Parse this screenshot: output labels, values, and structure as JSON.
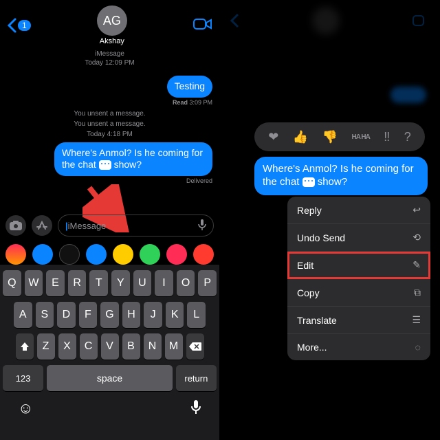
{
  "left": {
    "backCount": "1",
    "avatarInitials": "AG",
    "contactName": "Akshay",
    "serviceLabel": "iMessage",
    "todayLabel1": "Today 12:09 PM",
    "msg1": "Testing",
    "receipt1_prefix": "Read",
    "receipt1_time": "3:09 PM",
    "unsent1": "You unsent a message.",
    "unsent2": "You unsent a message.",
    "todayLabel2": "Today 4:18 PM",
    "msg2_a": "Where's Anmol? Is he coming for the chat ",
    "msg2_b": " show?",
    "receipt2": "Delivered",
    "placeholder": "iMessage",
    "keys": {
      "row1": [
        "Q",
        "W",
        "E",
        "R",
        "T",
        "Y",
        "U",
        "I",
        "O",
        "P"
      ],
      "row2": [
        "A",
        "S",
        "D",
        "F",
        "G",
        "H",
        "J",
        "K",
        "L"
      ],
      "row3": [
        "Z",
        "X",
        "C",
        "V",
        "B",
        "N",
        "M"
      ],
      "num": "123",
      "space": "space",
      "return": "return"
    }
  },
  "right": {
    "reactions": [
      "❤",
      "👍",
      "👎",
      "HA HA",
      "‼",
      "?"
    ],
    "bubble_a": "Where's Anmol? Is he coming for the chat ",
    "bubble_b": " show?",
    "menu": {
      "reply": "Reply",
      "undo": "Undo Send",
      "edit": "Edit",
      "copy": "Copy",
      "translate": "Translate",
      "more": "More..."
    }
  }
}
